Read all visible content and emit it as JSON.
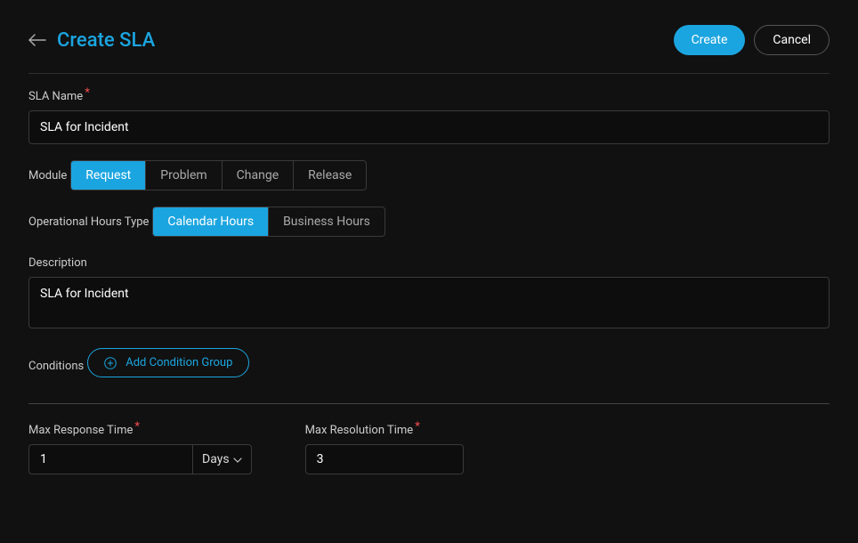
{
  "header": {
    "title": "Create SLA",
    "createBtn": "Create",
    "cancelBtn": "Cancel"
  },
  "slaName": {
    "label": "SLA Name",
    "value": "SLA for Incident"
  },
  "module": {
    "label": "Module",
    "options": [
      "Request",
      "Problem",
      "Change",
      "Release"
    ],
    "active": 0
  },
  "opHours": {
    "label": "Operational Hours Type",
    "options": [
      "Calendar Hours",
      "Business Hours"
    ],
    "active": 0
  },
  "description": {
    "label": "Description",
    "value": "SLA for Incident"
  },
  "conditions": {
    "label": "Conditions",
    "addBtn": "Add Condition Group"
  },
  "maxResponse": {
    "label": "Max Response Time",
    "value": "1",
    "unit": "Days"
  },
  "maxResolution": {
    "label": "Max Resolution Time",
    "value": "3"
  }
}
